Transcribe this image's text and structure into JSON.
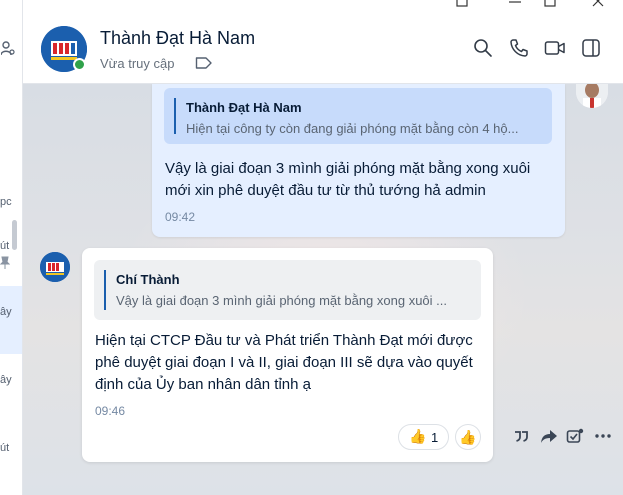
{
  "sidebar_fragments": {
    "frag1": "pc",
    "frag2": "út",
    "frag3": "ây",
    "frag4": "ây",
    "frag5": "út"
  },
  "header": {
    "title": "Thành Đạt Hà Nam",
    "status": "Vừa truy cập"
  },
  "messages": [
    {
      "side": "me",
      "quote_author": "Thành Đạt Hà Nam",
      "quote_text": "Hiện tại công ty còn đang giải phóng mặt bằng còn 4 hộ...",
      "line1": "Vậy là giai đoạn 3 mình giải phóng mặt bằng xong xuôi",
      "line2": "mới xin phê duyệt đầu tư từ thủ tướng hả admin",
      "time": "09:42"
    },
    {
      "side": "other",
      "quote_author": "Chí Thành",
      "quote_text": "Vậy là giai đoạn 3 mình giải phóng mặt bằng xong xuôi ...",
      "line1": "Hiện tại CTCP Đầu tư và Phát triển Thành Đạt mới được",
      "line2": "phê duyệt giai đoạn I và II, giai đoạn III sẽ dựa vào quyết",
      "line3": "định của Ủy ban nhân dân tỉnh ạ",
      "time": "09:46",
      "reaction_emoji": "👍",
      "reaction_count": "1",
      "react_button_emoji": "👍"
    }
  ],
  "colors": {
    "accent": "#1b5fae",
    "my_bubble": "#e5efff",
    "online": "#30a24a"
  }
}
